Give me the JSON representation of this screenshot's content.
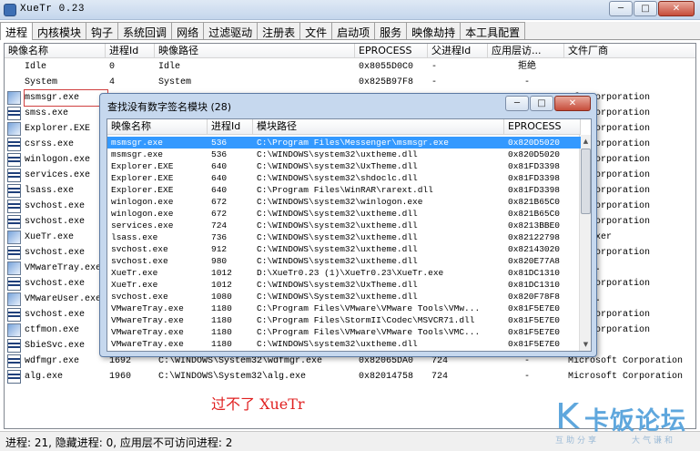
{
  "window": {
    "title": "XueTr 0.23",
    "min": "─",
    "max": "□",
    "close": "✕"
  },
  "tabs": [
    "进程",
    "内核模块",
    "钩子",
    "系统回调",
    "网络",
    "过滤驱动",
    "注册表",
    "文件",
    "启动项",
    "服务",
    "映像劫持",
    "本工具配置"
  ],
  "main": {
    "headers": [
      "映像名称",
      "进程Id",
      "映像路径",
      "EPROCESS",
      "父进程Id",
      "应用层访...",
      "文件厂商"
    ],
    "rows": [
      {
        "name": "Idle",
        "pid": "0",
        "path": "Idle",
        "eproc": "0x8055D0C0",
        "ppid": "-",
        "access": "拒绝",
        "vendor": "",
        "icon": "none"
      },
      {
        "name": "System",
        "pid": "4",
        "path": "System",
        "eproc": "0x825B97F8",
        "ppid": "-",
        "access": "-",
        "vendor": "",
        "icon": "none"
      },
      {
        "name": "msmsgr.exe",
        "pid": "",
        "path": "",
        "eproc": "",
        "ppid": "",
        "access": "",
        "vendor": "oft Corporation",
        "icon": "img"
      },
      {
        "name": "smss.exe",
        "pid": "",
        "path": "",
        "eproc": "",
        "ppid": "",
        "access": "",
        "vendor": "oft Corporation",
        "icon": "doc"
      },
      {
        "name": "Explorer.EXE",
        "pid": "",
        "path": "",
        "eproc": "",
        "ppid": "",
        "access": "",
        "vendor": "oft Corporation",
        "icon": "img"
      },
      {
        "name": "csrss.exe",
        "pid": "",
        "path": "",
        "eproc": "",
        "ppid": "",
        "access": "",
        "vendor": "oft Corporation",
        "icon": "doc"
      },
      {
        "name": "winlogon.exe",
        "pid": "",
        "path": "",
        "eproc": "",
        "ppid": "",
        "access": "",
        "vendor": "oft Corporation",
        "icon": "doc"
      },
      {
        "name": "services.exe",
        "pid": "",
        "path": "",
        "eproc": "",
        "ppid": "",
        "access": "",
        "vendor": "oft Corporation",
        "icon": "doc"
      },
      {
        "name": "lsass.exe",
        "pid": "",
        "path": "",
        "eproc": "",
        "ppid": "",
        "access": "",
        "vendor": "oft Corporation",
        "icon": "doc"
      },
      {
        "name": "svchost.exe",
        "pid": "",
        "path": "",
        "eproc": "",
        "ppid": "",
        "access": "",
        "vendor": "oft Corporation",
        "icon": "doc"
      },
      {
        "name": "svchost.exe",
        "pid": "",
        "path": "",
        "eproc": "",
        "ppid": "",
        "access": "",
        "vendor": "oft Corporation",
        "icon": "doc"
      },
      {
        "name": "XueTr.exe",
        "pid": "",
        "path": "",
        "eproc": "",
        "ppid": "",
        "access": "",
        "vendor": ": linxer",
        "icon": "img"
      },
      {
        "name": "svchost.exe",
        "pid": "",
        "path": "",
        "eproc": "",
        "ppid": "",
        "access": "",
        "vendor": "oft Corporation",
        "icon": "doc"
      },
      {
        "name": "VMwareTray.exe",
        "pid": "",
        "path": "",
        "eproc": "",
        "ppid": "",
        "access": "",
        "vendor": ", Inc.",
        "icon": "img"
      },
      {
        "name": "svchost.exe",
        "pid": "",
        "path": "",
        "eproc": "",
        "ppid": "",
        "access": "",
        "vendor": "oft Corporation",
        "icon": "doc"
      },
      {
        "name": "VMwareUser.exe",
        "pid": "",
        "path": "",
        "eproc": "",
        "ppid": "",
        "access": "",
        "vendor": ", Inc.",
        "icon": "img"
      },
      {
        "name": "svchost.exe",
        "pid": "",
        "path": "",
        "eproc": "",
        "ppid": "",
        "access": "",
        "vendor": "oft Corporation",
        "icon": "doc"
      },
      {
        "name": "ctfmon.exe",
        "pid": "",
        "path": "",
        "eproc": "",
        "ppid": "",
        "access": "",
        "vendor": "oft Corporation",
        "icon": "img"
      },
      {
        "name": "SbieSvc.exe",
        "pid": "",
        "path": "",
        "eproc": "",
        "ppid": "",
        "access": "",
        "vendor": "",
        "icon": "doc"
      },
      {
        "name": "wdfmgr.exe",
        "pid": "1692",
        "path": "C:\\WINDOWS\\System32\\wdfmgr.exe",
        "eproc": "0x82065DA0",
        "ppid": "724",
        "access": "-",
        "vendor": "Microsoft Corporation",
        "icon": "doc"
      },
      {
        "name": "alg.exe",
        "pid": "1960",
        "path": "C:\\WINDOWS\\System32\\alg.exe",
        "eproc": "0x82014758",
        "ppid": "724",
        "access": "-",
        "vendor": "Microsoft Corporation",
        "icon": "doc"
      }
    ]
  },
  "dialog": {
    "title": "查找没有数字签名模块 (28)",
    "headers": [
      "映像名称",
      "进程Id",
      "模块路径",
      "EPROCESS"
    ],
    "rows": [
      {
        "name": "msmsgr.exe",
        "pid": "536",
        "path": "C:\\Program Files\\Messenger\\msmsgr.exe",
        "eproc": "0x820D5020"
      },
      {
        "name": "msmsgr.exe",
        "pid": "536",
        "path": "C:\\WINDOWS\\system32\\uxtheme.dll",
        "eproc": "0x820D5020"
      },
      {
        "name": "Explorer.EXE",
        "pid": "640",
        "path": "C:\\WINDOWS\\system32\\UxTheme.dll",
        "eproc": "0x81FD3398"
      },
      {
        "name": "Explorer.EXE",
        "pid": "640",
        "path": "C:\\WINDOWS\\system32\\shdoclc.dll",
        "eproc": "0x81FD3398"
      },
      {
        "name": "Explorer.EXE",
        "pid": "640",
        "path": "C:\\Program Files\\WinRAR\\rarext.dll",
        "eproc": "0x81FD3398"
      },
      {
        "name": "winlogon.exe",
        "pid": "672",
        "path": "C:\\WINDOWS\\system32\\winlogon.exe",
        "eproc": "0x821B65C0"
      },
      {
        "name": "winlogon.exe",
        "pid": "672",
        "path": "C:\\WINDOWS\\system32\\uxtheme.dll",
        "eproc": "0x821B65C0"
      },
      {
        "name": "services.exe",
        "pid": "724",
        "path": "C:\\WINDOWS\\system32\\uxtheme.dll",
        "eproc": "0x8213BBE0"
      },
      {
        "name": "lsass.exe",
        "pid": "736",
        "path": "C:\\WINDOWS\\system32\\uxtheme.dll",
        "eproc": "0x82122798"
      },
      {
        "name": "svchost.exe",
        "pid": "912",
        "path": "C:\\WINDOWS\\system32\\uxtheme.dll",
        "eproc": "0x82143020"
      },
      {
        "name": "svchost.exe",
        "pid": "980",
        "path": "C:\\WINDOWS\\system32\\uxtheme.dll",
        "eproc": "0x820E77A8"
      },
      {
        "name": "XueTr.exe",
        "pid": "1012",
        "path": "D:\\XueTr0.23 (1)\\XueTr0.23\\XueTr.exe",
        "eproc": "0x81DC1310"
      },
      {
        "name": "XueTr.exe",
        "pid": "1012",
        "path": "C:\\WINDOWS\\system32\\UxTheme.dll",
        "eproc": "0x81DC1310"
      },
      {
        "name": "svchost.exe",
        "pid": "1080",
        "path": "C:\\WINDOWS\\System32\\uxtheme.dll",
        "eproc": "0x820F78F8"
      },
      {
        "name": "VMwareTray.exe",
        "pid": "1180",
        "path": "C:\\Program Files\\VMware\\VMware Tools\\VMw...",
        "eproc": "0x81F5E7E0"
      },
      {
        "name": "VMwareTray.exe",
        "pid": "1180",
        "path": "C:\\Program Files\\StormII\\Codec\\MSVCR71.dll",
        "eproc": "0x81F5E7E0"
      },
      {
        "name": "VMwareTray.exe",
        "pid": "1180",
        "path": "C:\\Program Files\\VMware\\VMware Tools\\VMC...",
        "eproc": "0x81F5E7E0"
      },
      {
        "name": "VMwareTray.exe",
        "pid": "1180",
        "path": "C:\\WINDOWS\\system32\\uxtheme.dll",
        "eproc": "0x81F5E7E0"
      }
    ]
  },
  "annotation": "过不了 XueTr",
  "status": "进程: 21, 隐藏进程: 0, 应用层不可访问进程: 2",
  "watermark": {
    "brand": "卡饭论坛",
    "slogan_left": "互助分享",
    "slogan_right": "大气谦和"
  }
}
